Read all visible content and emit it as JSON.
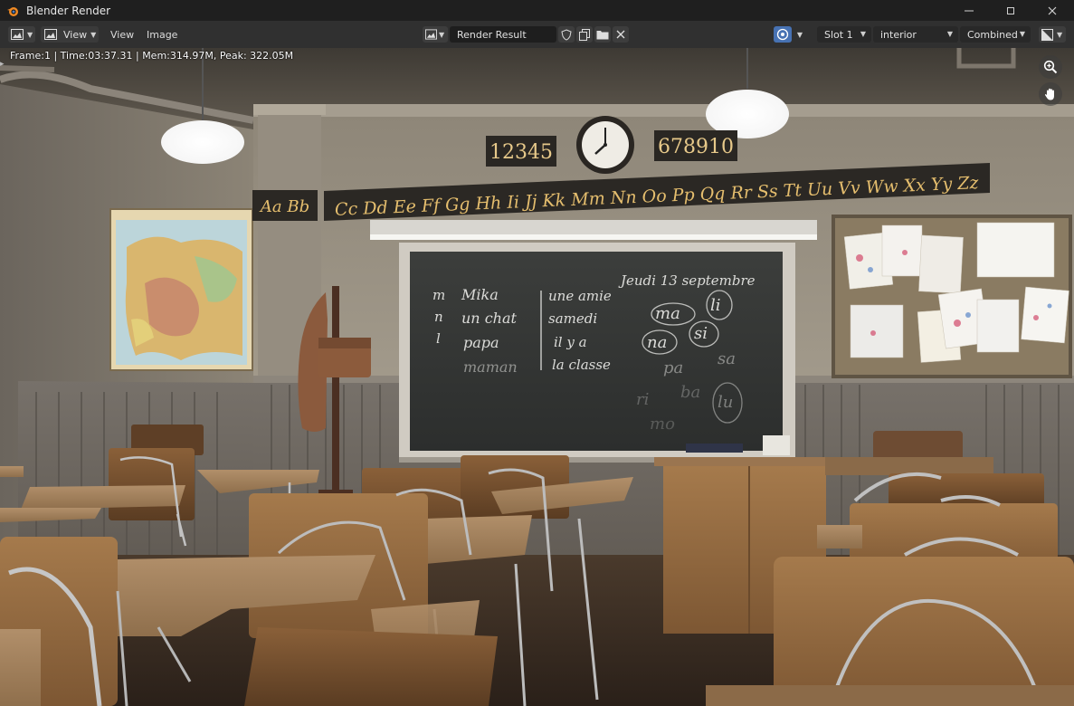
{
  "window": {
    "title": "Blender Render"
  },
  "toolbar": {
    "view_menu": "View",
    "view_menu2": "View",
    "image_menu": "Image",
    "image_name": "Render Result",
    "slot": "Slot 1",
    "layer": "interior",
    "pass": "Combined"
  },
  "stats": {
    "text": "Frame:1 | Time:03:37.31 | Mem:314.97M, Peak: 322.05M"
  },
  "render": {
    "numbers_left": "12345",
    "numbers_right": "678910",
    "alphabet_left": "Aa Bb",
    "alphabet_main": "Cc Dd Ee Ff Gg Hh Ii Jj Kk Mm Nn Oo Pp Qq Rr Ss Tt Uu Vv Ww Xx Yy Zz",
    "board_date": "Jeudi 13 septembre",
    "board_col1": [
      "m",
      "n",
      "l"
    ],
    "board_col2": [
      "Mika",
      "un chat",
      "papa",
      "maman"
    ],
    "board_col3": [
      "une amie",
      "samedi",
      "il y a",
      "la classe"
    ],
    "board_syllables": [
      "ma",
      "li",
      "na",
      "si",
      "pa",
      "sa",
      "ri",
      "ba",
      "lu",
      "mo"
    ]
  },
  "colors": {
    "titlebar": "#1f1f1f",
    "toolbar": "#303030",
    "accent": "#4772b3"
  }
}
